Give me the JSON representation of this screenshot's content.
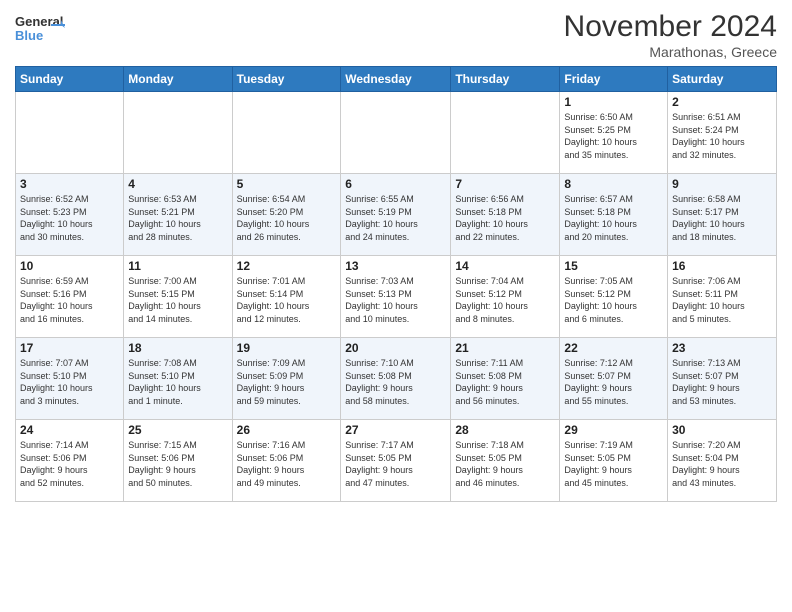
{
  "header": {
    "logo_line1": "General",
    "logo_line2": "Blue",
    "month_title": "November 2024",
    "location": "Marathonas, Greece"
  },
  "weekdays": [
    "Sunday",
    "Monday",
    "Tuesday",
    "Wednesday",
    "Thursday",
    "Friday",
    "Saturday"
  ],
  "weeks": [
    [
      {
        "day": "",
        "info": ""
      },
      {
        "day": "",
        "info": ""
      },
      {
        "day": "",
        "info": ""
      },
      {
        "day": "",
        "info": ""
      },
      {
        "day": "",
        "info": ""
      },
      {
        "day": "1",
        "info": "Sunrise: 6:50 AM\nSunset: 5:25 PM\nDaylight: 10 hours\nand 35 minutes."
      },
      {
        "day": "2",
        "info": "Sunrise: 6:51 AM\nSunset: 5:24 PM\nDaylight: 10 hours\nand 32 minutes."
      }
    ],
    [
      {
        "day": "3",
        "info": "Sunrise: 6:52 AM\nSunset: 5:23 PM\nDaylight: 10 hours\nand 30 minutes."
      },
      {
        "day": "4",
        "info": "Sunrise: 6:53 AM\nSunset: 5:21 PM\nDaylight: 10 hours\nand 28 minutes."
      },
      {
        "day": "5",
        "info": "Sunrise: 6:54 AM\nSunset: 5:20 PM\nDaylight: 10 hours\nand 26 minutes."
      },
      {
        "day": "6",
        "info": "Sunrise: 6:55 AM\nSunset: 5:19 PM\nDaylight: 10 hours\nand 24 minutes."
      },
      {
        "day": "7",
        "info": "Sunrise: 6:56 AM\nSunset: 5:18 PM\nDaylight: 10 hours\nand 22 minutes."
      },
      {
        "day": "8",
        "info": "Sunrise: 6:57 AM\nSunset: 5:18 PM\nDaylight: 10 hours\nand 20 minutes."
      },
      {
        "day": "9",
        "info": "Sunrise: 6:58 AM\nSunset: 5:17 PM\nDaylight: 10 hours\nand 18 minutes."
      }
    ],
    [
      {
        "day": "10",
        "info": "Sunrise: 6:59 AM\nSunset: 5:16 PM\nDaylight: 10 hours\nand 16 minutes."
      },
      {
        "day": "11",
        "info": "Sunrise: 7:00 AM\nSunset: 5:15 PM\nDaylight: 10 hours\nand 14 minutes."
      },
      {
        "day": "12",
        "info": "Sunrise: 7:01 AM\nSunset: 5:14 PM\nDaylight: 10 hours\nand 12 minutes."
      },
      {
        "day": "13",
        "info": "Sunrise: 7:03 AM\nSunset: 5:13 PM\nDaylight: 10 hours\nand 10 minutes."
      },
      {
        "day": "14",
        "info": "Sunrise: 7:04 AM\nSunset: 5:12 PM\nDaylight: 10 hours\nand 8 minutes."
      },
      {
        "day": "15",
        "info": "Sunrise: 7:05 AM\nSunset: 5:12 PM\nDaylight: 10 hours\nand 6 minutes."
      },
      {
        "day": "16",
        "info": "Sunrise: 7:06 AM\nSunset: 5:11 PM\nDaylight: 10 hours\nand 5 minutes."
      }
    ],
    [
      {
        "day": "17",
        "info": "Sunrise: 7:07 AM\nSunset: 5:10 PM\nDaylight: 10 hours\nand 3 minutes."
      },
      {
        "day": "18",
        "info": "Sunrise: 7:08 AM\nSunset: 5:10 PM\nDaylight: 10 hours\nand 1 minute."
      },
      {
        "day": "19",
        "info": "Sunrise: 7:09 AM\nSunset: 5:09 PM\nDaylight: 9 hours\nand 59 minutes."
      },
      {
        "day": "20",
        "info": "Sunrise: 7:10 AM\nSunset: 5:08 PM\nDaylight: 9 hours\nand 58 minutes."
      },
      {
        "day": "21",
        "info": "Sunrise: 7:11 AM\nSunset: 5:08 PM\nDaylight: 9 hours\nand 56 minutes."
      },
      {
        "day": "22",
        "info": "Sunrise: 7:12 AM\nSunset: 5:07 PM\nDaylight: 9 hours\nand 55 minutes."
      },
      {
        "day": "23",
        "info": "Sunrise: 7:13 AM\nSunset: 5:07 PM\nDaylight: 9 hours\nand 53 minutes."
      }
    ],
    [
      {
        "day": "24",
        "info": "Sunrise: 7:14 AM\nSunset: 5:06 PM\nDaylight: 9 hours\nand 52 minutes."
      },
      {
        "day": "25",
        "info": "Sunrise: 7:15 AM\nSunset: 5:06 PM\nDaylight: 9 hours\nand 50 minutes."
      },
      {
        "day": "26",
        "info": "Sunrise: 7:16 AM\nSunset: 5:06 PM\nDaylight: 9 hours\nand 49 minutes."
      },
      {
        "day": "27",
        "info": "Sunrise: 7:17 AM\nSunset: 5:05 PM\nDaylight: 9 hours\nand 47 minutes."
      },
      {
        "day": "28",
        "info": "Sunrise: 7:18 AM\nSunset: 5:05 PM\nDaylight: 9 hours\nand 46 minutes."
      },
      {
        "day": "29",
        "info": "Sunrise: 7:19 AM\nSunset: 5:05 PM\nDaylight: 9 hours\nand 45 minutes."
      },
      {
        "day": "30",
        "info": "Sunrise: 7:20 AM\nSunset: 5:04 PM\nDaylight: 9 hours\nand 43 minutes."
      }
    ]
  ]
}
